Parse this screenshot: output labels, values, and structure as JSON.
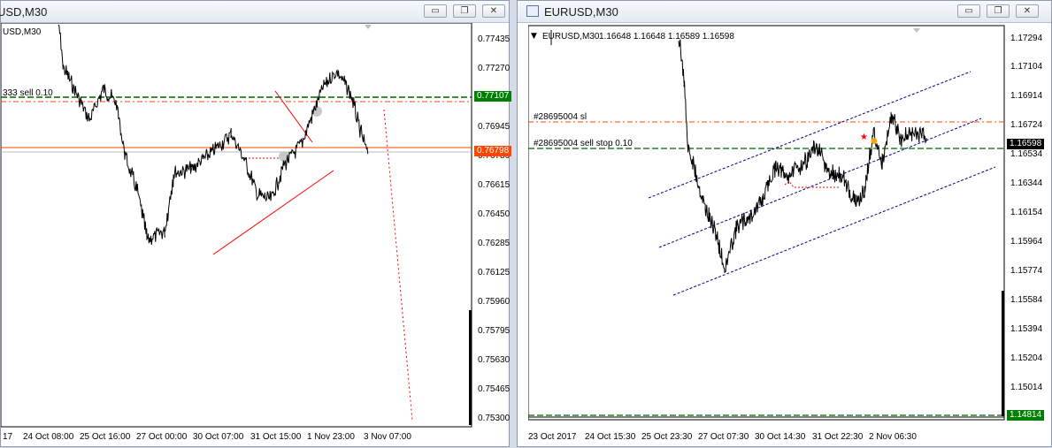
{
  "left_window": {
    "title": "USD,M30",
    "chart_label": "USD,M30",
    "order_label": "333 sell 0.10",
    "price_labels": [
      "0.77435",
      "0.77270",
      "0.76945",
      "0.76780",
      "0.76615",
      "0.76450",
      "0.76285",
      "0.76125",
      "0.75960",
      "0.75795",
      "0.75630",
      "0.75465",
      "0.75300"
    ],
    "badges": {
      "green": "0.77107",
      "orange": "0.76798"
    },
    "time_labels": [
      "17",
      "24 Oct 08:00",
      "25 Oct 16:00",
      "27 Oct 00:00",
      "30 Oct 07:00",
      "31 Oct 15:00",
      "1 Nov 23:00",
      "3 Nov 07:00"
    ]
  },
  "right_window": {
    "title": "EURUSD,M30",
    "chart_label": "EURUSD,M30",
    "ohlc": "1.16648 1.16648 1.16589 1.16598",
    "sl_label": "#28695004 sl",
    "order_label": "#28695004 sell stop 0.10",
    "price_labels": [
      "1.17294",
      "1.17104",
      "1.16914",
      "1.16724",
      "1.16534",
      "1.16344",
      "1.16154",
      "1.15964",
      "1.15774",
      "1.15584",
      "1.15394",
      "1.15204",
      "1.15014"
    ],
    "badges": {
      "current": "1.16598",
      "green": "1.14814"
    },
    "time_labels": [
      "23 Oct 2017",
      "24 Oct 15:30",
      "25 Oct 23:30",
      "27 Oct 07:30",
      "30 Oct 14:30",
      "31 Oct 22:30",
      "2 Nov 06:30"
    ]
  },
  "window_buttons": {
    "minimize": "▭",
    "restore": "❐",
    "close": "✕"
  },
  "colors": {
    "order_green": "#006400",
    "stop_loss_orange": "#ff4500",
    "channel_blue": "#00008b",
    "trend_red": "#ff0000",
    "badge_green": "#008000",
    "badge_orange": "#ff4500"
  }
}
